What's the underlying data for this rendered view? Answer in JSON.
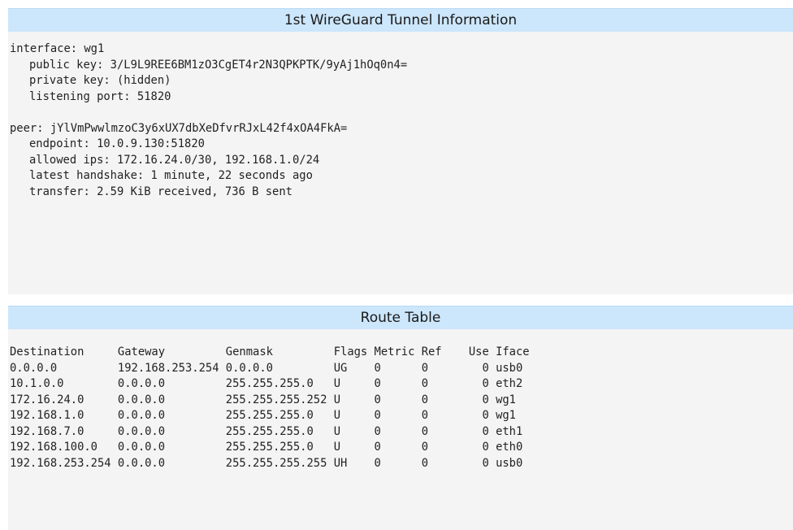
{
  "wireguard": {
    "title": "1st WireGuard Tunnel Information",
    "interface_line": "interface: wg1",
    "public_key_line": "public key: 3/L9L9REE6BM1zO3CgET4r2N3QPKPTK/9yAj1hOq0n4=",
    "private_key_line": "private key: (hidden)",
    "listening_port_line": "listening port: 51820",
    "peer_line": "peer: jYlVmPwwlmzoC3y6xUX7dbXeDfvrRJxL42f4xOA4FkA=",
    "endpoint_line": "endpoint: 10.0.9.130:51820",
    "allowed_ips_line": "allowed ips: 172.16.24.0/30, 192.168.1.0/24",
    "handshake_line": "latest handshake: 1 minute, 22 seconds ago",
    "transfer_line": "transfer: 2.59 KiB received, 736 B sent"
  },
  "route_table": {
    "title": "Route Table",
    "header_line": "Destination     Gateway         Genmask         Flags Metric Ref    Use Iface",
    "rows": [
      "0.0.0.0         192.168.253.254 0.0.0.0         UG    0      0        0 usb0",
      "10.1.0.0        0.0.0.0         255.255.255.0   U     0      0        0 eth2",
      "172.16.24.0     0.0.0.0         255.255.255.252 U     0      0        0 wg1",
      "192.168.1.0     0.0.0.0         255.255.255.0   U     0      0        0 wg1",
      "192.168.7.0     0.0.0.0         255.255.255.0   U     0      0        0 eth1",
      "192.168.100.0   0.0.0.0         255.255.255.0   U     0      0        0 eth0",
      "192.168.253.254 0.0.0.0         255.255.255.255 UH    0      0        0 usb0"
    ]
  }
}
